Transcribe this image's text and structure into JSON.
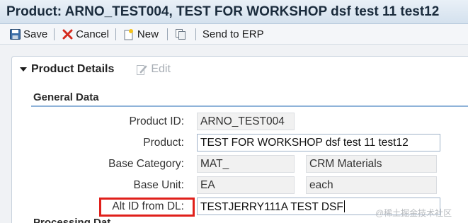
{
  "window": {
    "title": "Product: ARNO_TEST004, TEST FOR WORKSHOP dsf test 11 test12"
  },
  "toolbar": {
    "save_label": "Save",
    "save_icon": "save-disk-icon",
    "cancel_label": "Cancel",
    "cancel_icon": "red-x-icon",
    "new_label": "New",
    "new_icon": "new-document-icon",
    "copy_icon": "copy-icon",
    "send_label": "Send to ERP"
  },
  "panel": {
    "title": "Product Details",
    "edit_label": "Edit",
    "edit_icon": "edit-pencil-icon"
  },
  "section": {
    "title": "General Data",
    "next_title": "Processing Dat"
  },
  "fields": {
    "product_id": {
      "label": "Product ID:",
      "value": "ARNO_TEST004"
    },
    "product": {
      "label": "Product:",
      "value": "TEST FOR WORKSHOP dsf test 11 test12"
    },
    "base_category": {
      "label": "Base Category:",
      "code": "MAT_",
      "description": "CRM Materials"
    },
    "base_unit": {
      "label": "Base Unit:",
      "code": "EA",
      "description": "each"
    },
    "alt_id": {
      "label": "Alt ID from DL:",
      "value": "TESTJERRY111A TEST DSF"
    }
  },
  "watermark": "@稀土掘金技术社区",
  "colors": {
    "highlight": "#e0201b",
    "section_rule": "#8fb3d9",
    "title_bar": "#d4e1ee"
  }
}
